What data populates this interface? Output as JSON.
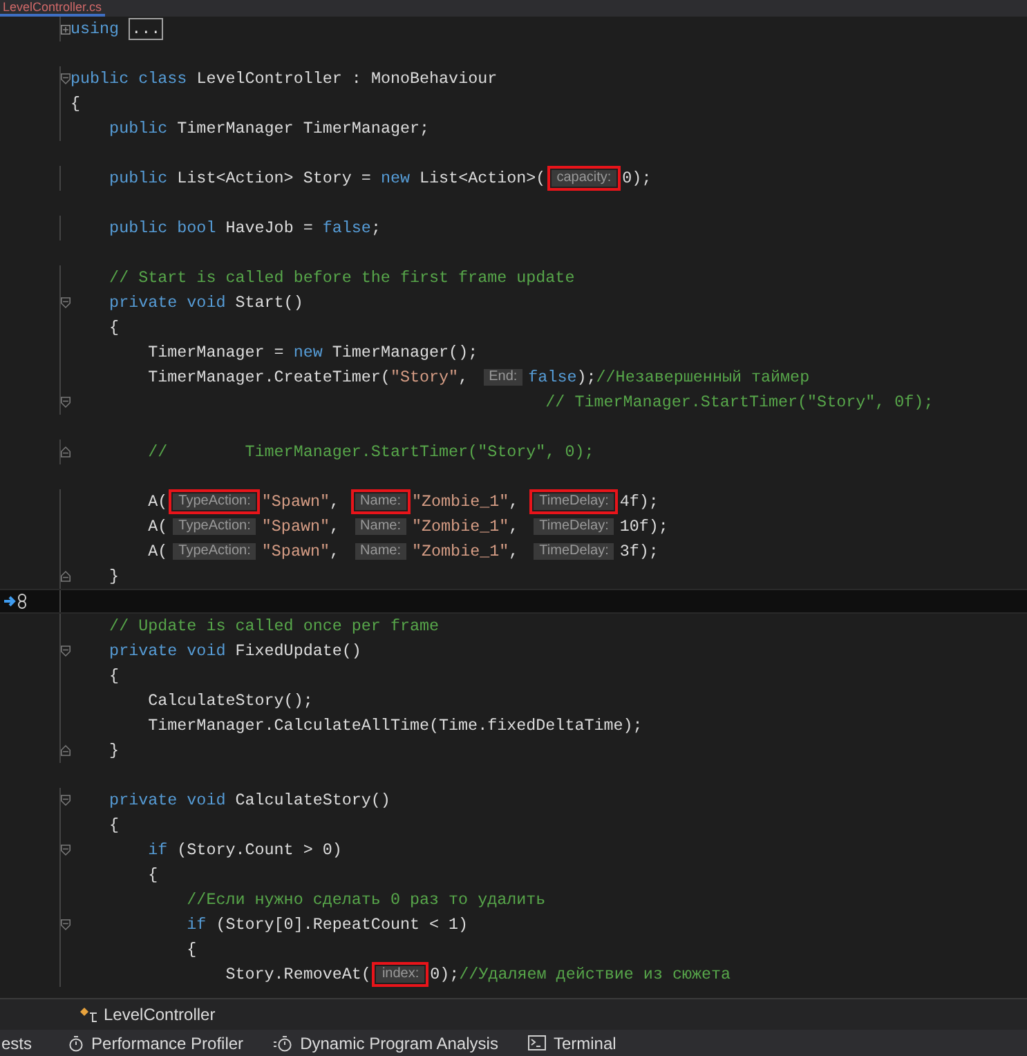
{
  "tab": {
    "title": "LevelController.cs",
    "selected": true
  },
  "lines": [
    {
      "collapsed": true,
      "tokens": [
        {
          "kind": "keyword",
          "text": "using"
        },
        {
          "kind": "collapsed",
          "text": "..."
        }
      ]
    },
    {
      "blank_before": true,
      "fold_start": true,
      "tokens": [
        {
          "kind": "keyword",
          "text": "public"
        },
        {
          "kind": "keyword",
          "text": " class"
        },
        {
          "kind": "plain",
          "text": " LevelController : MonoBehaviour"
        }
      ]
    },
    {
      "tokens": [
        {
          "kind": "plain",
          "text": "{"
        }
      ]
    },
    {
      "tokens": [
        {
          "kind": "keyword",
          "text": "    public"
        },
        {
          "kind": "plain",
          "text": " TimerManager TimerManager;"
        }
      ]
    },
    {
      "blank_before": true,
      "tokens": [
        {
          "kind": "keyword",
          "text": "    public"
        },
        {
          "kind": "plain",
          "text": " List<Action> Story = "
        },
        {
          "kind": "keyword",
          "text": "new"
        },
        {
          "kind": "plain",
          "text": " List<Action>("
        },
        {
          "kind": "hint",
          "text": "capacity:",
          "highlighted": true
        },
        {
          "kind": "plain",
          "text": "0);"
        }
      ]
    },
    {
      "blank_before": true,
      "tokens": [
        {
          "kind": "keyword",
          "text": "    public bool"
        },
        {
          "kind": "plain",
          "text": " HaveJob = "
        },
        {
          "kind": "keyword",
          "text": "false"
        },
        {
          "kind": "plain",
          "text": ";"
        }
      ]
    },
    {
      "blank_before": true,
      "tokens": [
        {
          "kind": "comment",
          "text": "    // Start is called before the first frame update"
        }
      ]
    },
    {
      "fold_start": true,
      "tokens": [
        {
          "kind": "keyword",
          "text": "    private void"
        },
        {
          "kind": "plain",
          "text": " Start()"
        }
      ]
    },
    {
      "tokens": [
        {
          "kind": "plain",
          "text": "    {"
        }
      ]
    },
    {
      "tokens": [
        {
          "kind": "plain",
          "text": "        TimerManager = "
        },
        {
          "kind": "keyword",
          "text": "new"
        },
        {
          "kind": "plain",
          "text": " TimerManager();"
        }
      ]
    },
    {
      "tokens": [
        {
          "kind": "plain",
          "text": "        TimerManager.CreateTimer("
        },
        {
          "kind": "string",
          "text": "\"Story\""
        },
        {
          "kind": "plain",
          "text": ", "
        },
        {
          "kind": "hint",
          "text": "End:",
          "highlighted": false
        },
        {
          "kind": "keyword",
          "text": "false"
        },
        {
          "kind": "plain",
          "text": ");"
        },
        {
          "kind": "comment",
          "text": "//Незавершенный таймер"
        }
      ]
    },
    {
      "fold_start": true,
      "tokens": [
        {
          "kind": "comment",
          "text": "                                                 // TimerManager.StartTimer(\"Story\", 0f);"
        }
      ]
    },
    {
      "blank_before": true,
      "fold_end": true,
      "tokens": [
        {
          "kind": "comment",
          "text": "        //        TimerManager.StartTimer(\"Story\", 0);"
        }
      ]
    },
    {
      "blank_before": true,
      "tokens": [
        {
          "kind": "plain",
          "text": "        A("
        },
        {
          "kind": "hint",
          "text": "TypeAction:",
          "highlighted": true
        },
        {
          "kind": "string",
          "text": "\"Spawn\""
        },
        {
          "kind": "plain",
          "text": ", "
        },
        {
          "kind": "hint",
          "text": "Name:",
          "highlighted": true
        },
        {
          "kind": "string",
          "text": "\"Zombie_1\""
        },
        {
          "kind": "plain",
          "text": ", "
        },
        {
          "kind": "hint",
          "text": "TimeDelay:",
          "highlighted": true
        },
        {
          "kind": "plain",
          "text": "4f);"
        }
      ]
    },
    {
      "tokens": [
        {
          "kind": "plain",
          "text": "        A("
        },
        {
          "kind": "hint",
          "text": "TypeAction:",
          "highlighted": false
        },
        {
          "kind": "string",
          "text": "\"Spawn\""
        },
        {
          "kind": "plain",
          "text": ", "
        },
        {
          "kind": "hint",
          "text": "Name:",
          "highlighted": false
        },
        {
          "kind": "string",
          "text": "\"Zombie_1\""
        },
        {
          "kind": "plain",
          "text": ", "
        },
        {
          "kind": "hint",
          "text": "TimeDelay:",
          "highlighted": false
        },
        {
          "kind": "plain",
          "text": "10f);"
        }
      ]
    },
    {
      "tokens": [
        {
          "kind": "plain",
          "text": "        A("
        },
        {
          "kind": "hint",
          "text": "TypeAction:",
          "highlighted": false
        },
        {
          "kind": "string",
          "text": "\"Spawn\""
        },
        {
          "kind": "plain",
          "text": ", "
        },
        {
          "kind": "hint",
          "text": "Name:",
          "highlighted": false
        },
        {
          "kind": "string",
          "text": "\"Zombie_1\""
        },
        {
          "kind": "plain",
          "text": ", "
        },
        {
          "kind": "hint",
          "text": "TimeDelay:",
          "highlighted": false
        },
        {
          "kind": "plain",
          "text": "3f);"
        }
      ]
    },
    {
      "fold_end": true,
      "tokens": [
        {
          "kind": "plain",
          "text": "    }"
        }
      ]
    },
    {
      "current": true
    },
    {
      "tokens": [
        {
          "kind": "comment",
          "text": "    // Update is called once per frame"
        }
      ]
    },
    {
      "fold_start": true,
      "tokens": [
        {
          "kind": "keyword",
          "text": "    private void"
        },
        {
          "kind": "plain",
          "text": " FixedUpdate()"
        }
      ]
    },
    {
      "tokens": [
        {
          "kind": "plain",
          "text": "    {"
        }
      ]
    },
    {
      "tokens": [
        {
          "kind": "plain",
          "text": "        CalculateStory();"
        }
      ]
    },
    {
      "tokens": [
        {
          "kind": "plain",
          "text": "        TimerManager.CalculateAllTime(Time.fixedDeltaTime);"
        }
      ]
    },
    {
      "fold_end": true,
      "tokens": [
        {
          "kind": "plain",
          "text": "    }"
        }
      ]
    },
    {
      "blank_before": true,
      "fold_start": true,
      "tokens": [
        {
          "kind": "keyword",
          "text": "    private void"
        },
        {
          "kind": "plain",
          "text": " CalculateStory()"
        }
      ]
    },
    {
      "tokens": [
        {
          "kind": "plain",
          "text": "    {"
        }
      ]
    },
    {
      "fold_start": true,
      "tokens": [
        {
          "kind": "keyword",
          "text": "        if"
        },
        {
          "kind": "plain",
          "text": " (Story.Count > 0)"
        }
      ]
    },
    {
      "tokens": [
        {
          "kind": "plain",
          "text": "        {"
        }
      ]
    },
    {
      "tokens": [
        {
          "kind": "comment",
          "text": "            //Если нужно сделать 0 раз то удалить"
        }
      ]
    },
    {
      "fold_start": true,
      "tokens": [
        {
          "kind": "keyword",
          "text": "            if"
        },
        {
          "kind": "plain",
          "text": " (Story[0].RepeatCount < 1)"
        }
      ]
    },
    {
      "tokens": [
        {
          "kind": "plain",
          "text": "            {"
        }
      ]
    },
    {
      "tokens": [
        {
          "kind": "plain",
          "text": "                Story.RemoveAt("
        },
        {
          "kind": "hint",
          "text": "index:",
          "highlighted": true
        },
        {
          "kind": "plain",
          "text": "0);"
        },
        {
          "kind": "comment",
          "text": "//Удаляем действие из сюжета"
        }
      ]
    }
  ],
  "breadcrumb": {
    "label": "LevelController"
  },
  "tool_tabs": [
    {
      "kind": "tests",
      "label": "ests"
    },
    {
      "kind": "profiler",
      "label": "Performance Profiler"
    },
    {
      "kind": "analysis",
      "label": "Dynamic Program Analysis"
    },
    {
      "kind": "terminal",
      "label": "Terminal"
    }
  ]
}
